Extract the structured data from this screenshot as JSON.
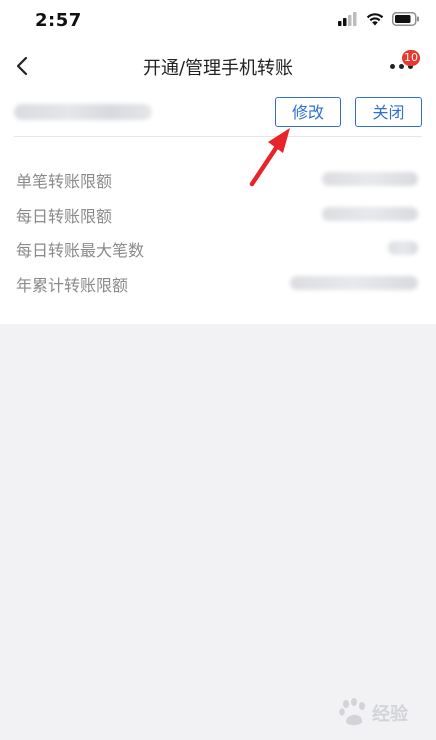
{
  "status_bar": {
    "time": "2:57"
  },
  "nav": {
    "title": "开通/管理手机转账",
    "badge_count": "10"
  },
  "account": {
    "buttons": {
      "modify": "修改",
      "close": "关闭"
    }
  },
  "limits": [
    {
      "label": "单笔转账限额"
    },
    {
      "label": "每日转账限额"
    },
    {
      "label": "每日转账最大笔数"
    },
    {
      "label": "年累计转账限额"
    }
  ],
  "colors": {
    "accent": "#2f6fd6",
    "badge": "#e8392f",
    "annotation_arrow": "#e8232a"
  },
  "watermark": {
    "text": "经验"
  }
}
